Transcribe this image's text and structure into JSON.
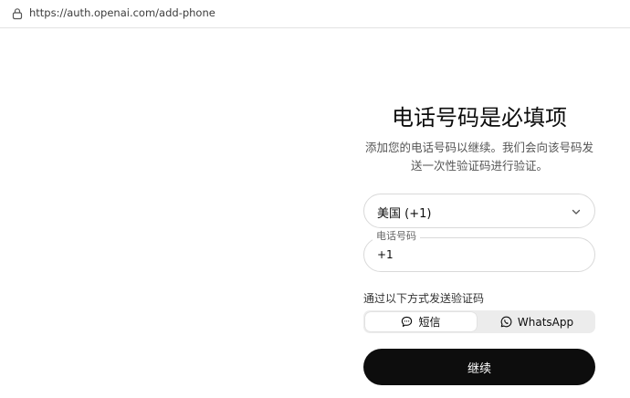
{
  "browser": {
    "url": "https://auth.openai.com/add-phone"
  },
  "page": {
    "title": "电话号码是必填项",
    "subtitle": "添加您的电话号码以继续。我们会向该号码发送一次性验证码进行验证。"
  },
  "form": {
    "country_value": "美国 (+1)",
    "phone_label": "电话号码",
    "phone_value": "+1",
    "method_label": "通过以下方式发送验证码",
    "methods": [
      {
        "label": "短信",
        "icon": "message-icon",
        "selected": true
      },
      {
        "label": "WhatsApp",
        "icon": "whatsapp-icon",
        "selected": false
      }
    ],
    "continue_label": "继续"
  }
}
